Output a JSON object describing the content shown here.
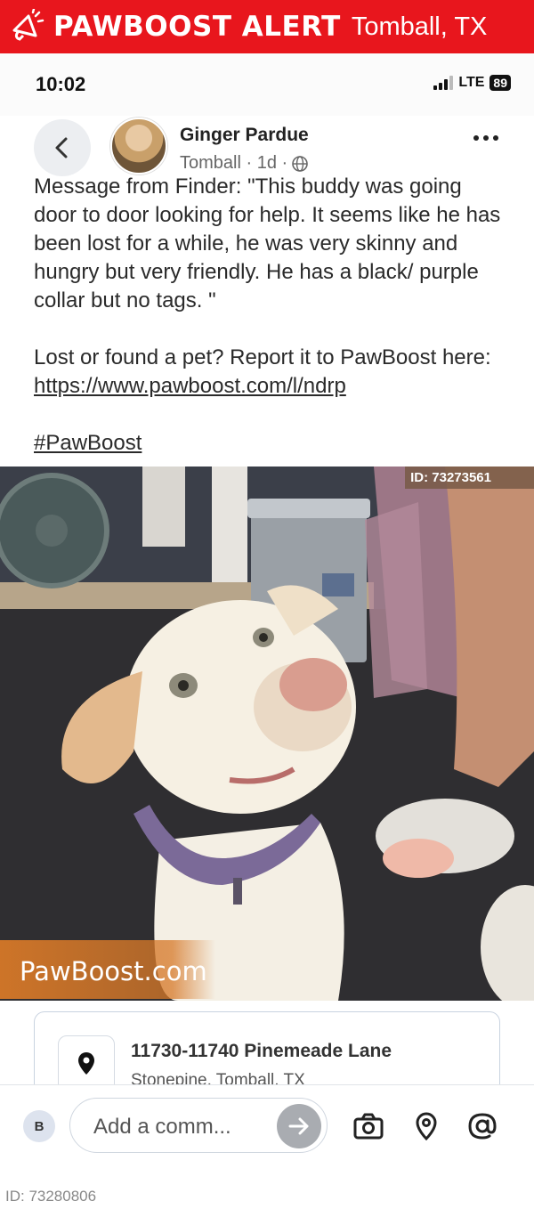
{
  "banner": {
    "title": "PAWBOOST ALERT",
    "location": "Tomball, TX",
    "icon": "megaphone-icon",
    "color": "#e8161d"
  },
  "status_bar": {
    "time": "10:02",
    "network": "LTE",
    "battery": "89"
  },
  "post": {
    "author": "Ginger Pardue",
    "meta": "Tomball · 1d ·",
    "paragraph1": "Message from Finder: \"This buddy was going door to door looking for help. It seems like he has been lost for a while, he was very skinny and hungry but very friendly. He has a black/ purple collar but no tags. \"",
    "paragraph2_prefix": "Lost or found a pet? Report it to PawBoost here: ",
    "link": "https://www.pawboost.com/l/ndrp",
    "hashtag": "#PawBoost"
  },
  "photo": {
    "id_label": "ID: 73273561",
    "watermark": "PawBoost.com"
  },
  "address": {
    "line1": "11730-11740 Pinemeade Lane",
    "line2": "Stonepine, Tomball, TX"
  },
  "comment_bar": {
    "avatar_initial": "B",
    "placeholder": "Add a comm..."
  },
  "footer": {
    "id": "ID: 73280806"
  }
}
